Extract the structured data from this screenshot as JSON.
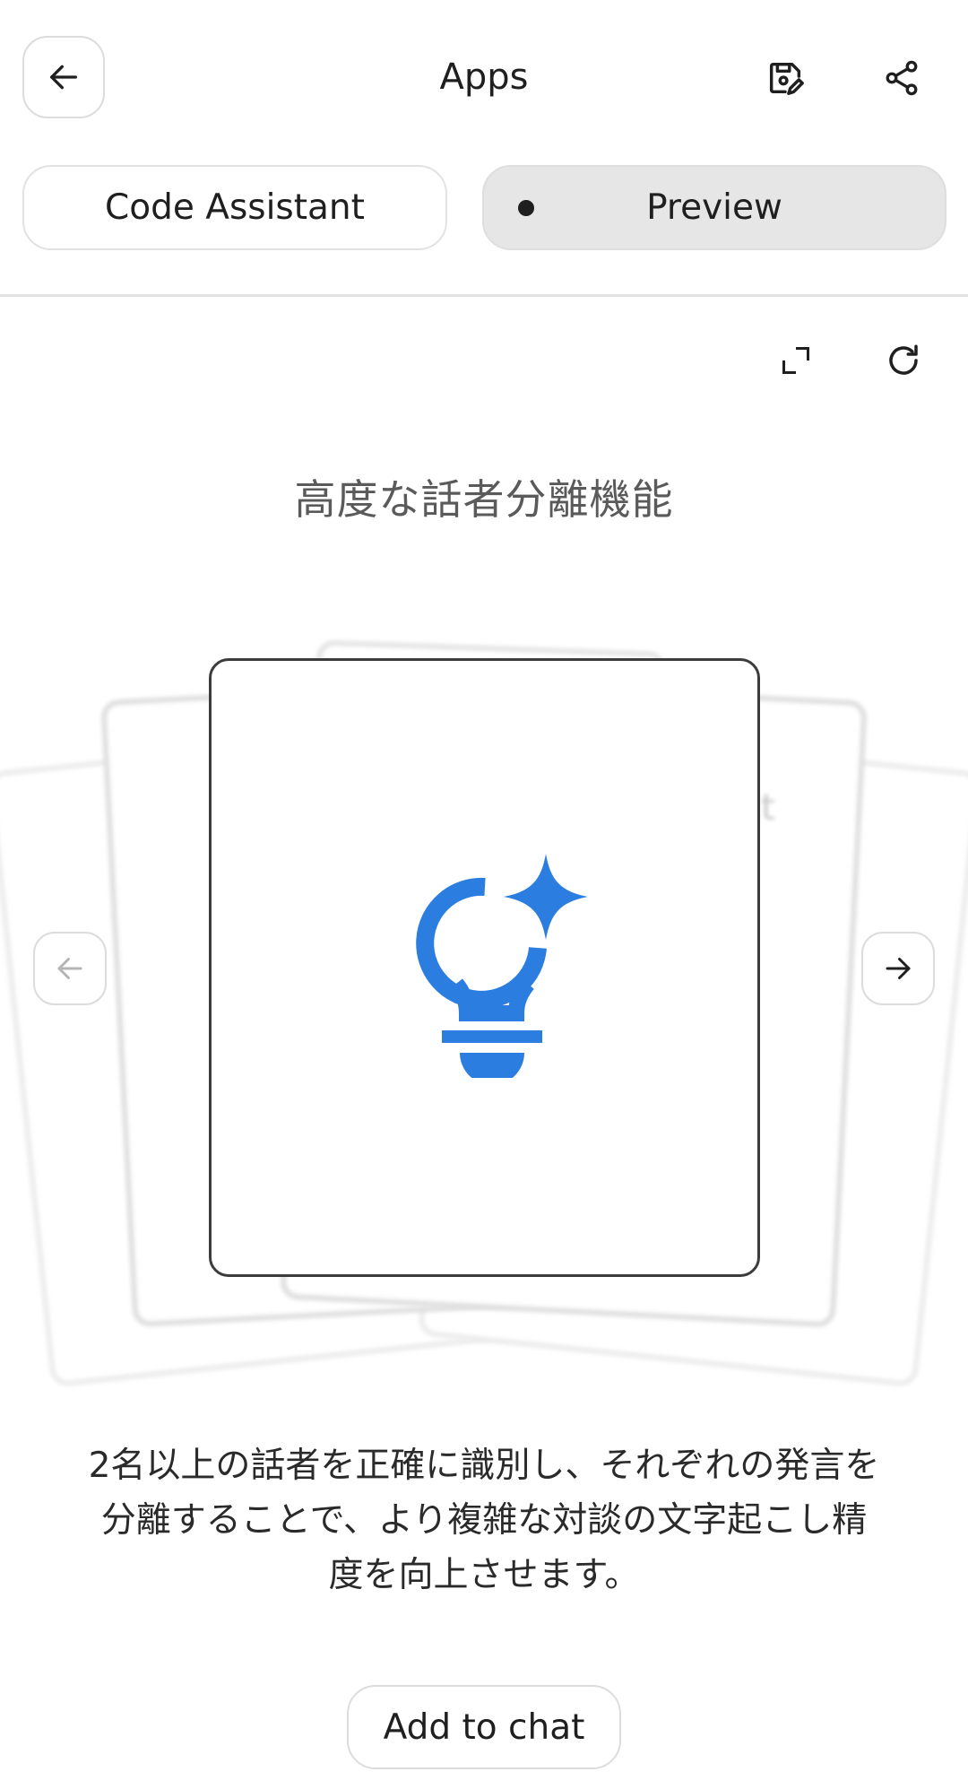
{
  "header": {
    "title": "Apps",
    "back_icon": "arrow-left-icon",
    "save_edit_icon": "save-edit-icon",
    "share_icon": "share-icon"
  },
  "tabs": [
    {
      "label": "Code Assistant",
      "selected": false
    },
    {
      "label": "Preview",
      "selected": true
    }
  ],
  "toolbar": {
    "expand_icon": "expand-icon",
    "refresh_icon": "refresh-icon"
  },
  "preview": {
    "feature_title": "高度な話者分離機能",
    "card_icon": "lightbulb-sparkle-icon",
    "background_card_partial_text": "lt",
    "description_lines": [
      "2名以上の話者を正確に識別し、それぞれの発言を",
      "分離することで、より複雑な対談の文字起こし精",
      "度を向上させます。"
    ],
    "add_button_label": "Add to chat"
  },
  "colors": {
    "accent_blue": "#2b7de0",
    "selected_tab_bg": "#e6e6e6",
    "text": "#1f1f1f",
    "muted_text": "#5a5a5a"
  }
}
